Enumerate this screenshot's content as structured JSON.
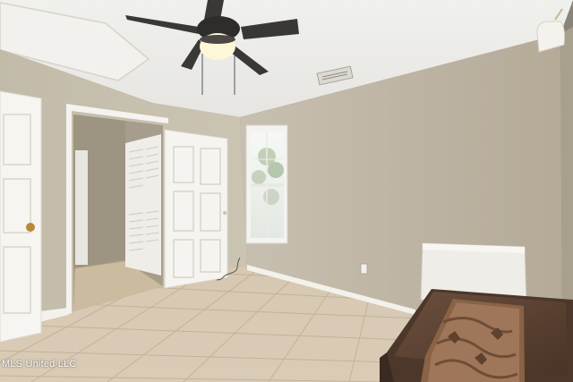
{
  "photo": {
    "subject": "empty-bedroom-interior",
    "watermark": "MLS United LLC"
  },
  "colors": {
    "wall": "#c3b9a8",
    "ceiling": "#eeeeeb",
    "floor_tile": "#d9cbb5",
    "door": "#f4f3ef",
    "baseboard": "#f1efe9",
    "fan_body": "#3b3937",
    "chest_wood": "#5a4233"
  }
}
